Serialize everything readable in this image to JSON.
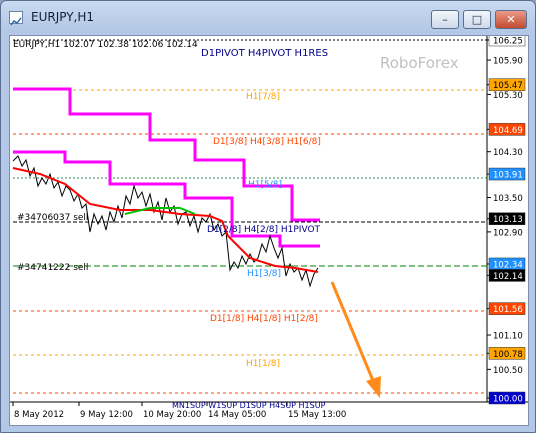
{
  "window": {
    "title": "EURJPY,H1",
    "buttons": {
      "minimize": "–",
      "maximize": "□",
      "close": "✕"
    }
  },
  "chart": {
    "info_line": "EURJPY,H1  102.07 102.38 102.06 102.14",
    "header_label": "D1PIVOT H4PIVOT H1RES",
    "watermark": "RoboForex",
    "annotations": {
      "h1_7_8": "H1[7/8]",
      "mix_3_8": "D1[3/8] H4[3/8] H1[6/8]",
      "h1_5_8": "H1[5/8]",
      "mix_pivot": "D1[2/8] H4[2/8] H1PIVOT",
      "h1_3_8": "H1[3/8]",
      "mix_1_8": "D1[1/8] H4[1/8] H1[2/8]",
      "h1_1_8": "H1[1/8]",
      "bottom": "MN1SUP W1SUP D1SUP H4SUP H1SUP"
    },
    "orders": {
      "sell1": "#34706037 sell",
      "sell2": "#34741222 sell"
    },
    "price_axis": [
      {
        "label": "106.25",
        "value": 106.25,
        "box": true,
        "fill": "#ffffff",
        "text": "#000000"
      },
      {
        "label": "105.90",
        "value": 105.9,
        "box": false
      },
      {
        "label": "105.47",
        "value": 105.47,
        "box": true,
        "fill": "#ffa500",
        "text": "#000000"
      },
      {
        "label": "105.30",
        "value": 105.3,
        "box": false
      },
      {
        "label": "104.69",
        "value": 104.69,
        "box": true,
        "fill": "#ff4500",
        "text": "#ffffff"
      },
      {
        "label": "104.30",
        "value": 104.3,
        "box": false
      },
      {
        "label": "103.91",
        "value": 103.91,
        "box": true,
        "fill": "#1e90ff",
        "text": "#ffffff"
      },
      {
        "label": "103.50",
        "value": 103.5,
        "box": false
      },
      {
        "label": "103.13",
        "value": 103.13,
        "box": true,
        "fill": "#000000",
        "text": "#ffffff"
      },
      {
        "label": "102.90",
        "value": 102.9,
        "box": false
      },
      {
        "label": "102.34",
        "value": 102.34,
        "box": true,
        "fill": "#1e90ff",
        "text": "#ffffff"
      },
      {
        "label": "102.14",
        "value": 102.14,
        "box": true,
        "fill": "#000000",
        "text": "#ffffff"
      },
      {
        "label": "101.56",
        "value": 101.56,
        "box": true,
        "fill": "#ff4500",
        "text": "#ffffff"
      },
      {
        "label": "101.10",
        "value": 101.1,
        "box": false
      },
      {
        "label": "100.78",
        "value": 100.78,
        "box": true,
        "fill": "#ffa500",
        "text": "#000000"
      },
      {
        "label": "100.50",
        "value": 100.5,
        "box": false
      },
      {
        "label": "100.00",
        "value": 100.0,
        "box": true,
        "fill": "#0000cd",
        "text": "#ffffff"
      }
    ],
    "time_axis": [
      "8 May 2012",
      "9 May 12:00",
      "10 May 20:00",
      "14 May 05:00",
      "15 May 13:00"
    ],
    "colors": {
      "resistance": "#ff00ff",
      "ma": "#ff0000",
      "ma_alt": "#00c000",
      "forecast_arrow": "#ff8c1a",
      "price": "#000000"
    }
  }
}
